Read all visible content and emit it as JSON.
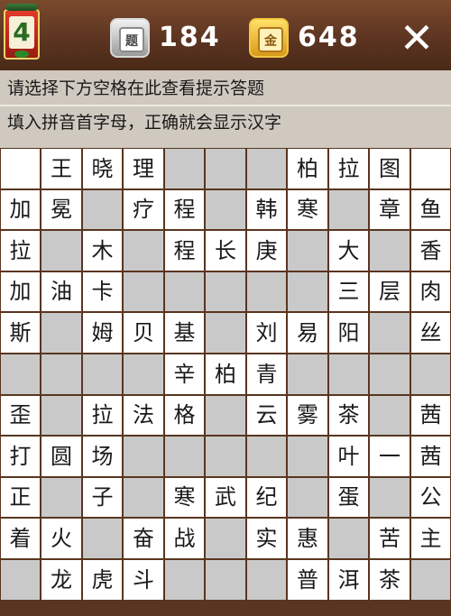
{
  "header": {
    "level": "4",
    "question_icon_label": "题",
    "question_count": "184",
    "gold_icon_label": "金",
    "gold_count": "648",
    "close_symbol": "✕"
  },
  "hint": {
    "line1": "请选择下方空格在此查看提示答题",
    "line2": "填入拼音首字母，正确就会显示汉字"
  },
  "colors": {
    "board_bg": "#5a3520",
    "white_cell": "#ffffff",
    "gray_cell": "#c9c9c9",
    "hint_bg": "#cfc9bf"
  },
  "grid": {
    "rows": 11,
    "cols": 11,
    "cells": [
      [
        "",
        "王",
        "晓",
        "理",
        "#",
        "#",
        "#",
        "柏",
        "拉",
        "图",
        ""
      ],
      [
        "加",
        "冕",
        "#",
        "疗",
        "程",
        "#",
        "韩",
        "寒",
        "#",
        "章",
        "鱼"
      ],
      [
        "拉",
        "#",
        "木",
        "#",
        "程",
        "长",
        "庚",
        "#",
        "大",
        "#",
        "香"
      ],
      [
        "加",
        "油",
        "卡",
        "#",
        "#",
        "#",
        "#",
        "#",
        "三",
        "层",
        "肉"
      ],
      [
        "斯",
        "#",
        "姆",
        "贝",
        "基",
        "#",
        "刘",
        "易",
        "阳",
        "#",
        "丝"
      ],
      [
        "#",
        "#",
        "#",
        "#",
        "辛",
        "柏",
        "青",
        "#",
        "#",
        "#",
        "#"
      ],
      [
        "歪",
        "#",
        "拉",
        "法",
        "格",
        "#",
        "云",
        "雾",
        "茶",
        "#",
        "茜"
      ],
      [
        "打",
        "圆",
        "场",
        "#",
        "#",
        "#",
        "#",
        "#",
        "叶",
        "一",
        "茜"
      ],
      [
        "正",
        "#",
        "子",
        "#",
        "寒",
        "武",
        "纪",
        "#",
        "蛋",
        "#",
        "公"
      ],
      [
        "着",
        "火",
        "#",
        "奋",
        "战",
        "#",
        "实",
        "惠",
        "#",
        "苦",
        "主"
      ],
      [
        "#",
        "龙",
        "虎",
        "斗",
        "#",
        "#",
        "#",
        "普",
        "洱",
        "茶",
        "#"
      ]
    ]
  }
}
